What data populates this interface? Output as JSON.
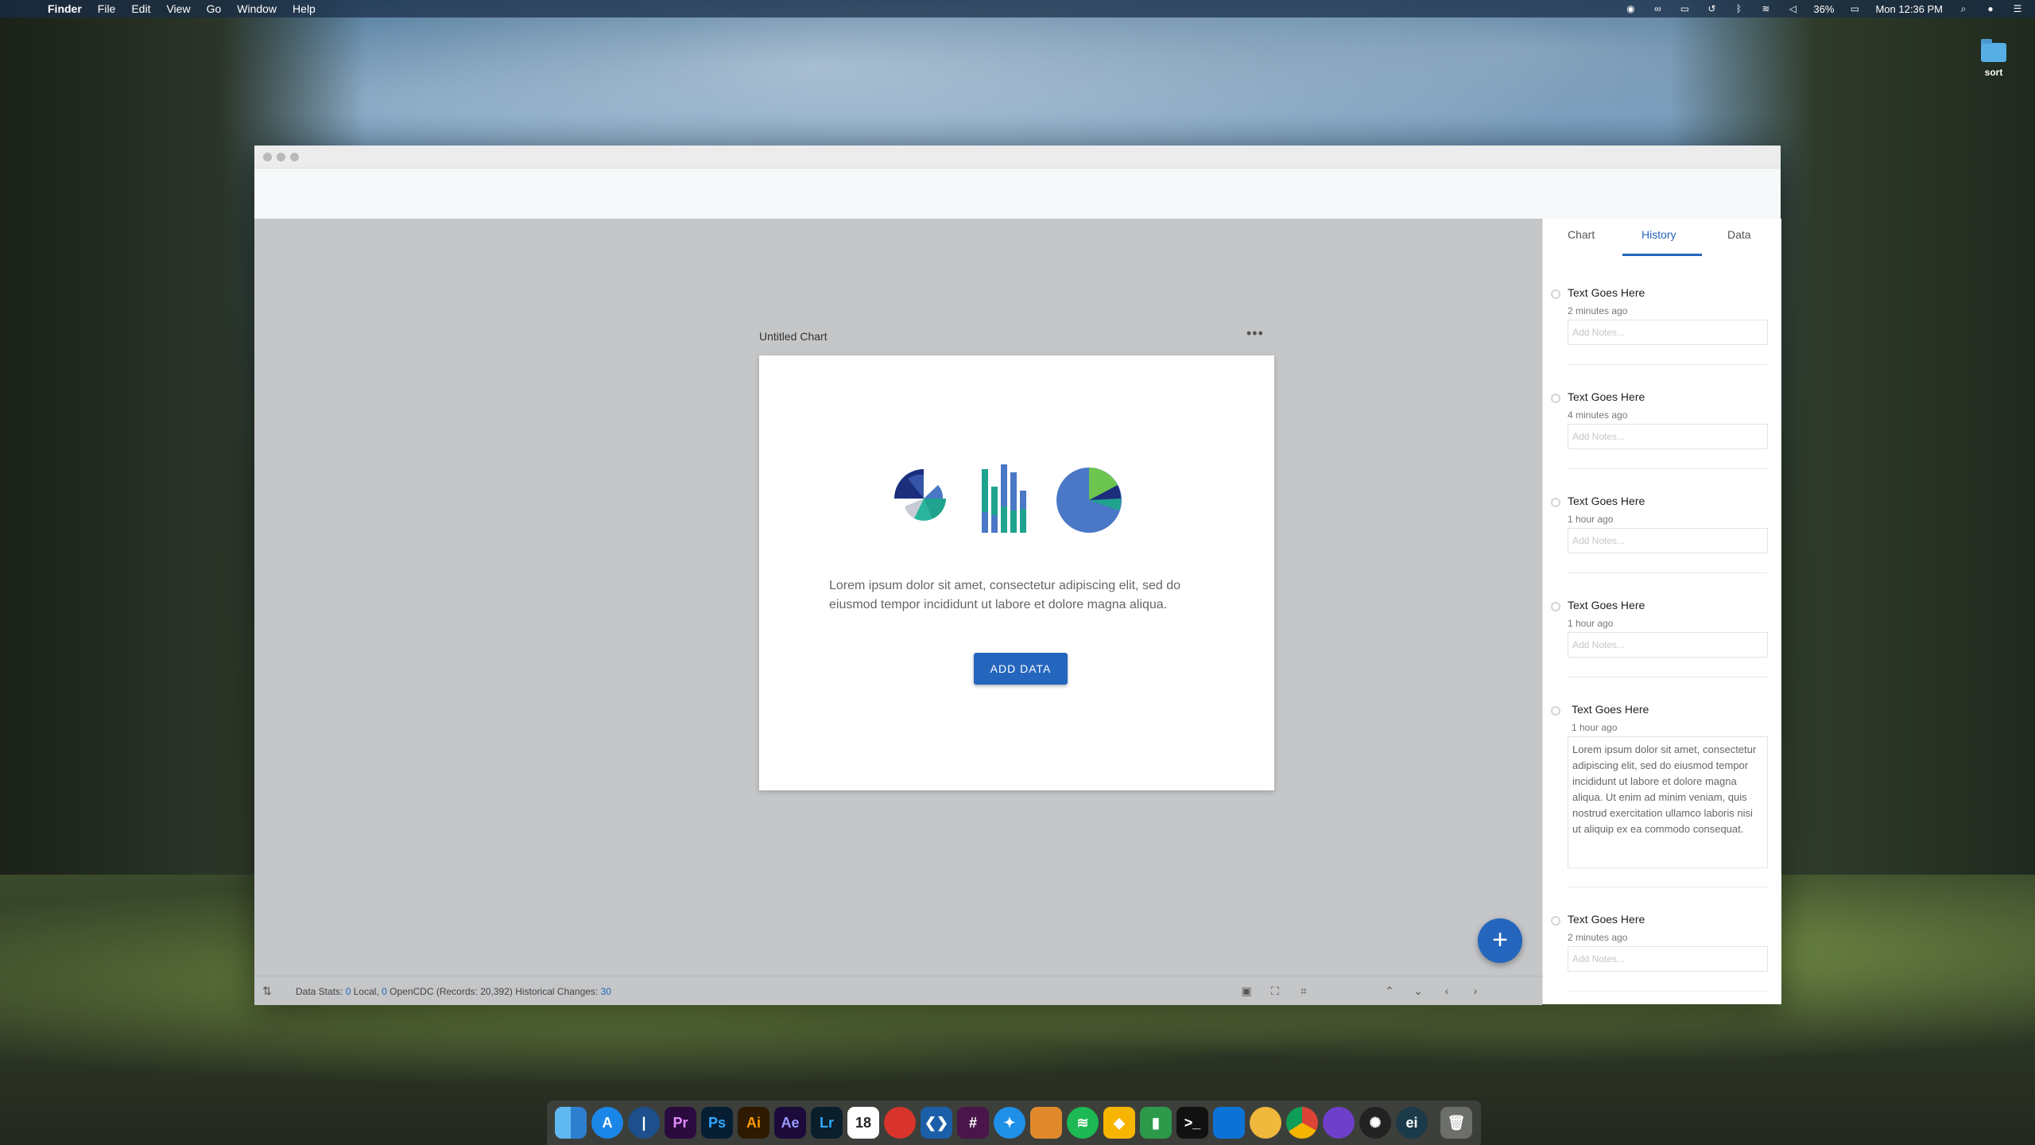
{
  "menubar": {
    "app": "Finder",
    "items": [
      "File",
      "Edit",
      "View",
      "Go",
      "Window",
      "Help"
    ],
    "battery": "36%",
    "clock": "Mon 12:36 PM"
  },
  "desktop": {
    "folder_label": "sort"
  },
  "chart": {
    "title": "Untitled Chart",
    "more": "•••",
    "description": "Lorem ipsum dolor sit amet, consectetur adipiscing elit, sed do eiusmod tempor incididunt ut labore et dolore magna aliqua.",
    "add_button": "ADD DATA"
  },
  "fab": {
    "label": "+"
  },
  "status": {
    "prefix": "Data Stats:",
    "local_count": "0",
    "local_label": "Local,",
    "opencdc_count": "0",
    "opencdc_label": "OpenCDC (Records: 20,392) Historical Changes:",
    "changes": "30"
  },
  "panel": {
    "tabs": [
      "Chart",
      "History",
      "Data"
    ],
    "active_tab": "History",
    "history": [
      {
        "title": "Text Goes Here",
        "time": "2 minutes ago",
        "notes_placeholder": "Add Notes..."
      },
      {
        "title": "Text Goes Here",
        "time": "4 minutes ago",
        "notes_placeholder": "Add Notes..."
      },
      {
        "title": "Text Goes Here",
        "time": "1 hour ago",
        "notes_placeholder": "Add Notes..."
      },
      {
        "title": "Text Goes Here",
        "time": "1 hour ago",
        "notes_placeholder": "Add Notes..."
      },
      {
        "title": "Text Goes Here",
        "time": "1 hour ago",
        "notes_text": "Lorem ipsum dolor sit amet, consectetur adipiscing elit, sed do eiusmod tempor incididunt ut labore et dolore magna aliqua. Ut enim ad minim veniam, quis nostrud exercitation ullamco laboris nisi ut aliquip ex ea commodo consequat."
      },
      {
        "title": "Text Goes Here",
        "time": "2 minutes ago",
        "notes_placeholder": "Add Notes..."
      }
    ]
  },
  "dock": {
    "calendar_day": "18",
    "app_icons": [
      "finder-icon",
      "app-store-icon",
      "1password-icon",
      "premiere-icon",
      "photoshop-icon",
      "illustrator-icon",
      "after-effects-icon",
      "lightroom-icon",
      "calendar-icon",
      "affinity-icon",
      "vscode-icon",
      "slack-icon",
      "safari-icon",
      "transmit-icon",
      "spotify-icon",
      "sketch-icon",
      "numbers-icon",
      "terminal-icon",
      "framer-icon",
      "cyberduck-icon",
      "chrome-icon",
      "github-icon",
      "siri-icon",
      "electron-icon",
      "trash-icon"
    ],
    "labels": {
      "premiere": "Pr",
      "photoshop": "Ps",
      "illustrator": "Ai",
      "after_effects": "Ae",
      "lightroom": "Lr"
    }
  },
  "colors": {
    "accent": "#2466bd",
    "canvas": "#c4c6c8",
    "teal": "#1fa38e",
    "navy": "#1b2e7c",
    "green": "#6cc54f",
    "mid_blue": "#4a78c6"
  }
}
